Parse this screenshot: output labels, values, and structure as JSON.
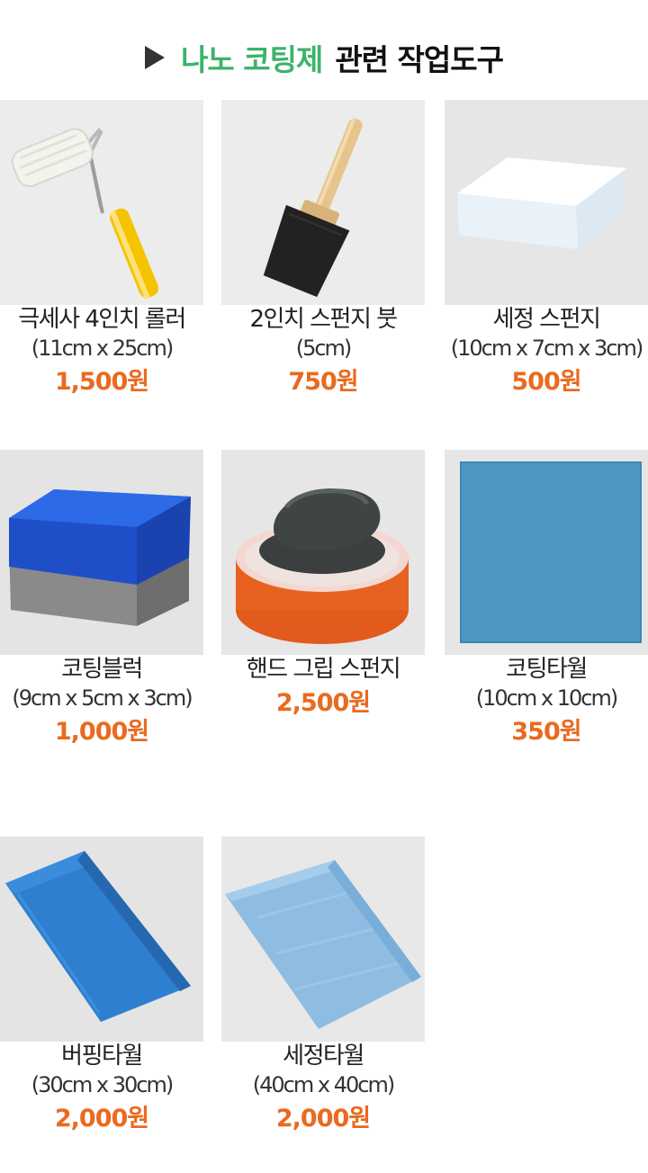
{
  "header": {
    "highlight": "나노 코팅제",
    "rest": "관련 작업도구",
    "highlight_color": "#3db36a"
  },
  "price_color": "#ea6a1f",
  "products": [
    {
      "name": "극세사 4인치 롤러",
      "size": "(11cm x 25cm)",
      "price": "1,500원",
      "image": "paint-roller"
    },
    {
      "name": "2인치 스펀지 붓",
      "size": "(5cm)",
      "price": "750원",
      "image": "foam-brush"
    },
    {
      "name": "세정 스펀지",
      "size": "(10cm x 7cm x 3cm)",
      "price": "500원",
      "image": "white-sponge"
    },
    {
      "name": "코팅블럭",
      "size": "(9cm x 5cm x 3cm)",
      "price": "1,000원",
      "image": "blue-block"
    },
    {
      "name": "핸드 그립 스펀지",
      "size": "",
      "price": "2,500원",
      "image": "grip-pad"
    },
    {
      "name": "코팅타월",
      "size": "(10cm x 10cm)",
      "price": "350원",
      "image": "blue-square-towel"
    },
    {
      "name": "버핑타월",
      "size": "(30cm x 30cm)",
      "price": "2,000원",
      "image": "blue-buffing-towel"
    },
    {
      "name": "세정타월",
      "size": "(40cm x 40cm)",
      "price": "2,000원",
      "image": "light-blue-towel"
    }
  ]
}
